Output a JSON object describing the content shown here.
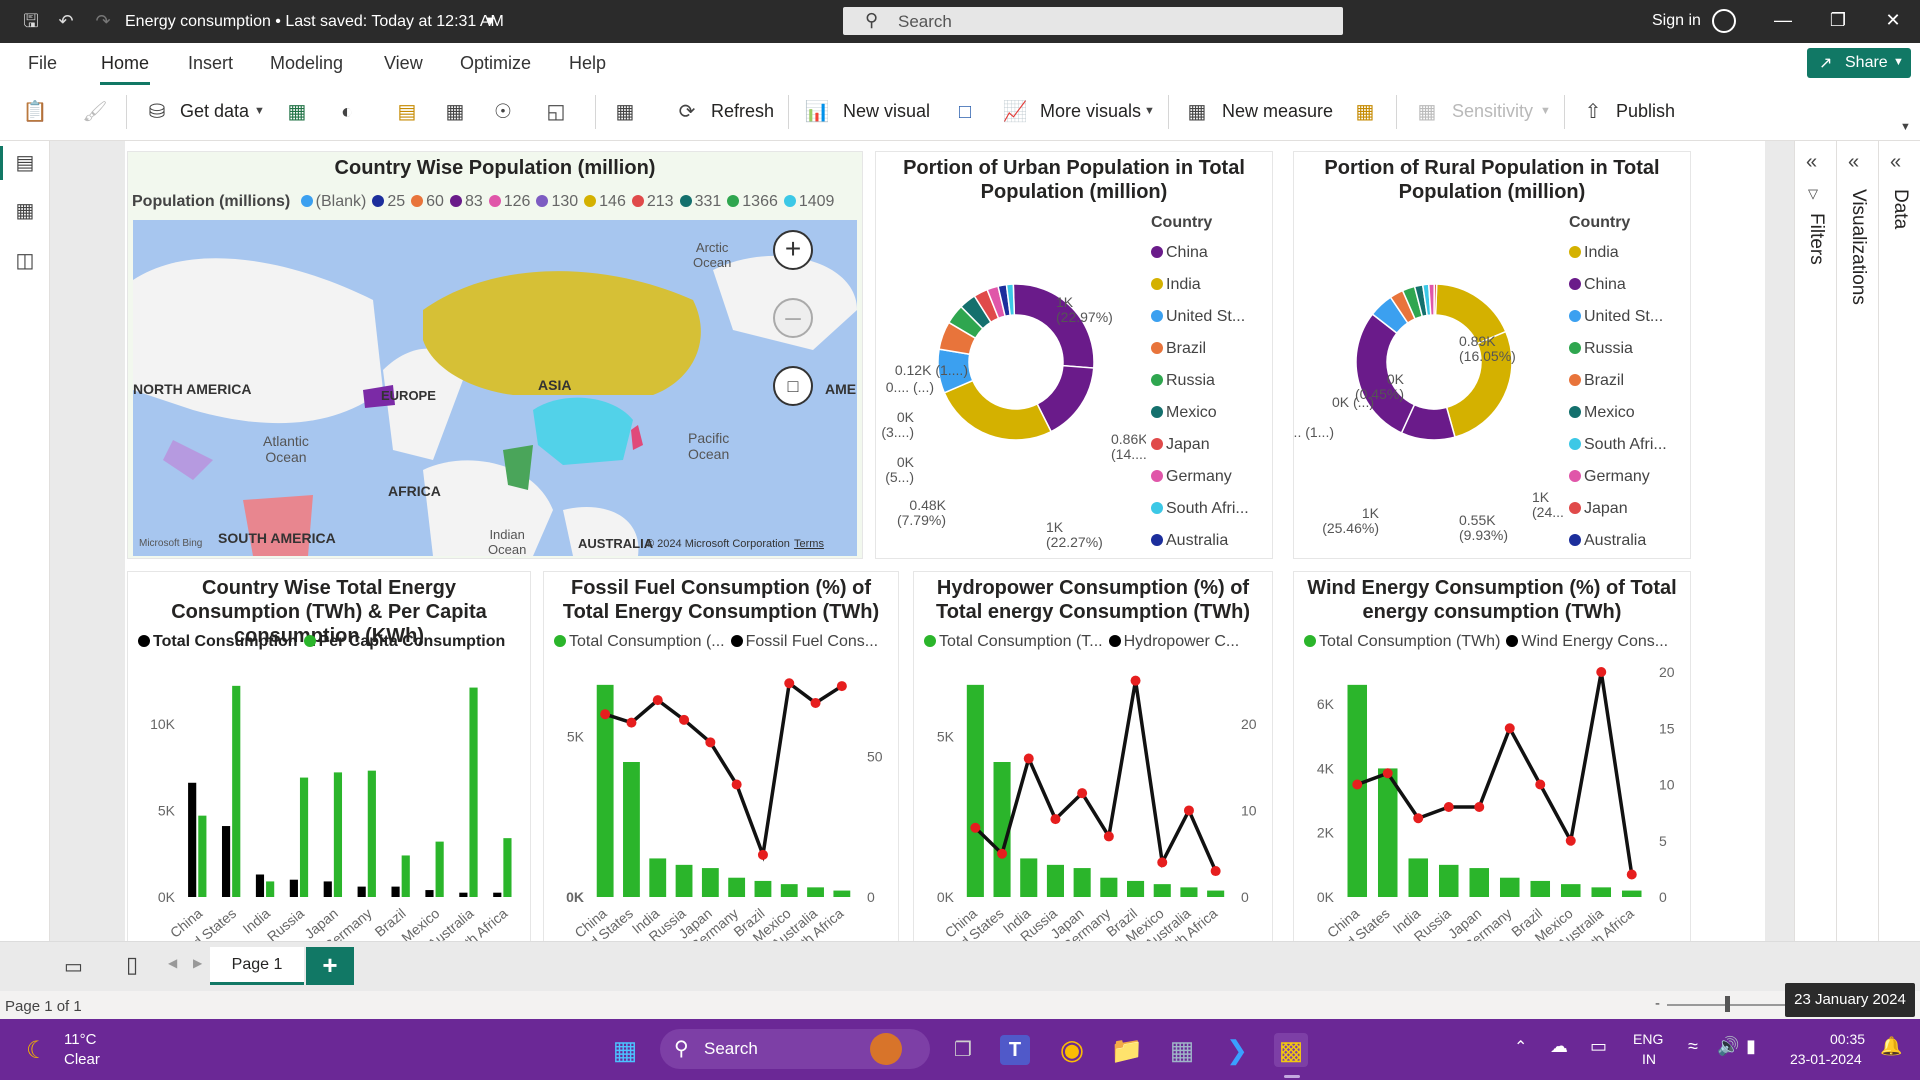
{
  "window": {
    "title": "Energy consumption • Last saved: Today at 12:31 AM",
    "search_placeholder": "Search",
    "signin": "Sign in"
  },
  "menu": [
    "File",
    "Home",
    "Insert",
    "Modeling",
    "View",
    "Optimize",
    "Help"
  ],
  "share_label": "Share",
  "ribbon": {
    "get_data": "Get data",
    "refresh": "Refresh",
    "new_visual": "New visual",
    "more_visuals": "More visuals",
    "new_measure": "New measure",
    "sensitivity": "Sensitivity",
    "publish": "Publish"
  },
  "panels": {
    "filters": "Filters",
    "visualizations": "Visualizations",
    "data": "Data"
  },
  "map_card": {
    "title": "Country Wise Population (million)",
    "legend_title": "Population (millions)",
    "legend": [
      {
        "label": "(Blank)",
        "color": "#3ba0f0"
      },
      {
        "label": "25",
        "color": "#1c2e9c"
      },
      {
        "label": "60",
        "color": "#e8743b"
      },
      {
        "label": "83",
        "color": "#6a1b8a"
      },
      {
        "label": "126",
        "color": "#e056a9"
      },
      {
        "label": "130",
        "color": "#7d5cc2"
      },
      {
        "label": "146",
        "color": "#d4b100"
      },
      {
        "label": "213",
        "color": "#e04a4a"
      },
      {
        "label": "331",
        "color": "#14706d"
      },
      {
        "label": "1366",
        "color": "#2fa64f"
      },
      {
        "label": "1409",
        "color": "#3cc8e6"
      }
    ],
    "labels": {
      "arctic": "Arctic\nOcean",
      "north_america": "NORTH AMERICA",
      "europe": "EUROPE",
      "asia": "ASIA",
      "atlantic": "Atlantic\nOcean",
      "pacific": "Pacific\nOcean",
      "africa": "AFRICA",
      "south_america": "SOUTH AMERICA",
      "indian": "Indian\nOcean",
      "australia": "AUSTRALIA",
      "ame": "AME",
      "bing": "Microsoft Bing",
      "copyright": "© 2024 Microsoft Corporation",
      "terms": "Terms"
    }
  },
  "urban_card": {
    "title": "Portion of Urban Population in Total Population (million)",
    "legend_title": "Country",
    "legend": [
      {
        "label": "China",
        "color": "#6a1b8a"
      },
      {
        "label": "India",
        "color": "#d4b100"
      },
      {
        "label": "United St...",
        "color": "#3ba0f0"
      },
      {
        "label": "Brazil",
        "color": "#e8743b"
      },
      {
        "label": "Russia",
        "color": "#2fa64f"
      },
      {
        "label": "Mexico",
        "color": "#14706d"
      },
      {
        "label": "Japan",
        "color": "#e04a4a"
      },
      {
        "label": "Germany",
        "color": "#e056a9"
      },
      {
        "label": "South Afri...",
        "color": "#3cc8e6"
      },
      {
        "label": "Australia",
        "color": "#1c2e9c"
      }
    ],
    "slices": [
      {
        "label": "China",
        "value": 22.97,
        "color": "#6a1b8a"
      },
      {
        "label": "Russia",
        "value": 14.0,
        "color": "#6a1b8a"
      },
      {
        "label": "India",
        "value": 22.27,
        "color": "#d4b100"
      },
      {
        "label": "United States",
        "value": 7.79,
        "color": "#3ba0f0"
      },
      {
        "label": "Brazil",
        "value": 5.0,
        "color": "#e8743b"
      },
      {
        "label": "Russia2",
        "value": 3.5,
        "color": "#2fa64f"
      },
      {
        "label": "Mexico",
        "value": 3.0,
        "color": "#14706d"
      },
      {
        "label": "Japan",
        "value": 2.5,
        "color": "#e04a4a"
      },
      {
        "label": "Germany",
        "value": 2.0,
        "color": "#e056a9"
      },
      {
        "label": "Australia",
        "value": 1.5,
        "color": "#1c2e9c"
      },
      {
        "label": "South Africa",
        "value": 1.2,
        "color": "#3cc8e6"
      }
    ],
    "data_labels": {
      "a": "1K\n(22.97%)",
      "b": "0.86K\n(14....)",
      "c": "1K\n(22.27%)",
      "d": "0.48K\n(7.79%)",
      "e": "0K\n(5...)",
      "f": "0K\n(3....)",
      "g": "0.... (...)",
      "h": "0.12K (1....)"
    }
  },
  "rural_card": {
    "title": "Portion of Rural Population in Total Population (million)",
    "legend_title": "Country",
    "legend": [
      {
        "label": "India",
        "color": "#d4b100"
      },
      {
        "label": "China",
        "color": "#6a1b8a"
      },
      {
        "label": "United St...",
        "color": "#3ba0f0"
      },
      {
        "label": "Russia",
        "color": "#2fa64f"
      },
      {
        "label": "Brazil",
        "color": "#e8743b"
      },
      {
        "label": "Mexico",
        "color": "#14706d"
      },
      {
        "label": "South Afri...",
        "color": "#3cc8e6"
      },
      {
        "label": "Germany",
        "color": "#e056a9"
      },
      {
        "label": "Japan",
        "color": "#e04a4a"
      },
      {
        "label": "Australia",
        "color": "#1c2e9c"
      }
    ],
    "slices": [
      {
        "label": "India",
        "value": 16.05,
        "color": "#d4b100"
      },
      {
        "label": "India2",
        "value": 24.0,
        "color": "#d4b100"
      },
      {
        "label": "China",
        "value": 9.93,
        "color": "#6a1b8a"
      },
      {
        "label": "China2",
        "value": 25.46,
        "color": "#6a1b8a"
      },
      {
        "label": "United States",
        "value": 4.5,
        "color": "#3ba0f0"
      },
      {
        "label": "Brazil",
        "value": 2.5,
        "color": "#e8743b"
      },
      {
        "label": "Russia",
        "value": 2.3,
        "color": "#2fa64f"
      },
      {
        "label": "Mexico",
        "value": 1.5,
        "color": "#14706d"
      },
      {
        "label": "South Africa",
        "value": 1.1,
        "color": "#3cc8e6"
      },
      {
        "label": "Germany",
        "value": 1.0,
        "color": "#e056a9"
      },
      {
        "label": "Japan",
        "value": 0.45,
        "color": "#e04a4a"
      }
    ],
    "data_labels": {
      "a": "0.89K\n(16.05%)",
      "b": "1K\n(24....)",
      "c": "0.55K\n(9.93%)",
      "d": "1K\n(25.46%)",
      "e": "0.... (1...)",
      "f": "0K (...)",
      "g": "0K\n(0.45%)"
    }
  },
  "chart_data": [
    {
      "type": "bar",
      "title": "Country Wise Total Energy Consumption (TWh) & Per Capita consumption (KWh)",
      "categories": [
        "China",
        "United States",
        "India",
        "Russia",
        "Japan",
        "Germany",
        "Brazil",
        "Mexico",
        "Australia",
        "South Africa"
      ],
      "series": [
        {
          "name": "Total Consumption",
          "color": "#000000",
          "values": [
            6600,
            4100,
            1300,
            1000,
            900,
            600,
            600,
            400,
            250,
            250
          ]
        },
        {
          "name": "Per Capita Consumption",
          "color": "#2bb52b",
          "values": [
            4700,
            12200,
            900,
            6900,
            7200,
            7300,
            2400,
            3200,
            12100,
            3400
          ]
        }
      ],
      "y_ticks": [
        "0K",
        "5K",
        "10K"
      ],
      "ylim": [
        0,
        13000
      ]
    },
    {
      "type": "bar+line",
      "title": "Fossil Fuel Consumption (%) of Total Energy Consumption (TWh)",
      "categories": [
        "China",
        "United States",
        "India",
        "Russia",
        "Japan",
        "Germany",
        "Brazil",
        "Mexico",
        "Australia",
        "South Africa"
      ],
      "series": [
        {
          "name": "Total Consumption (...",
          "color": "#2bb52b",
          "values": [
            6600,
            4200,
            1200,
            1000,
            900,
            600,
            500,
            400,
            300,
            200
          ]
        },
        {
          "name": "Fossil Fuel Cons...",
          "color": "#000000",
          "values": [
            65,
            62,
            70,
            63,
            55,
            40,
            15,
            76,
            69,
            75
          ]
        }
      ],
      "y_ticks": [
        "0K",
        "5K"
      ],
      "y2_ticks": [
        "0",
        "50"
      ],
      "ylim": [
        0,
        7000
      ],
      "y2lim": [
        0,
        80
      ]
    },
    {
      "type": "bar+line",
      "title": "Hydropower Consumption (%) of Total energy Consumption (TWh)",
      "categories": [
        "China",
        "United States",
        "India",
        "Russia",
        "Japan",
        "Germany",
        "Brazil",
        "Mexico",
        "Australia",
        "South Africa"
      ],
      "series": [
        {
          "name": "Total Consumption (T...",
          "color": "#2bb52b",
          "values": [
            6600,
            4200,
            1200,
            1000,
            900,
            600,
            500,
            400,
            300,
            200
          ]
        },
        {
          "name": "Hydropower C...",
          "color": "#000000",
          "values": [
            8,
            5,
            16,
            9,
            12,
            7,
            25,
            4,
            10,
            3
          ]
        }
      ],
      "y_ticks": [
        "0K",
        "5K"
      ],
      "y2_ticks": [
        "0",
        "10",
        "20"
      ],
      "ylim": [
        0,
        7000
      ],
      "y2lim": [
        0,
        26
      ]
    },
    {
      "type": "bar+line",
      "title": "Wind Energy Consumption (%) of Total energy consumption (TWh)",
      "categories": [
        "China",
        "United States",
        "India",
        "Russia",
        "Japan",
        "Germany",
        "Brazil",
        "Mexico",
        "Australia",
        "South Africa"
      ],
      "series": [
        {
          "name": "Total Consumption (TWh)",
          "color": "#2bb52b",
          "values": [
            6600,
            4000,
            1200,
            1000,
            900,
            600,
            500,
            400,
            300,
            200
          ]
        },
        {
          "name": "Wind Energy Cons...",
          "color": "#000000",
          "values": [
            10,
            11,
            7,
            8,
            8,
            15,
            10,
            5,
            20,
            2
          ]
        }
      ],
      "y_ticks": [
        "0K",
        "2K",
        "4K",
        "6K"
      ],
      "y2_ticks": [
        "0",
        "5",
        "10",
        "15",
        "20"
      ],
      "ylim": [
        0,
        7000
      ],
      "y2lim": [
        0,
        20
      ]
    }
  ],
  "pages": {
    "tab": "Page 1",
    "status": "Page 1 of 1"
  },
  "tooltip": "23 January 2024",
  "taskbar": {
    "weather_temp": "11°C",
    "weather_desc": "Clear",
    "search": "Search",
    "lang": "ENG",
    "region": "IN",
    "time": "00:35",
    "date": "23-01-2024"
  }
}
